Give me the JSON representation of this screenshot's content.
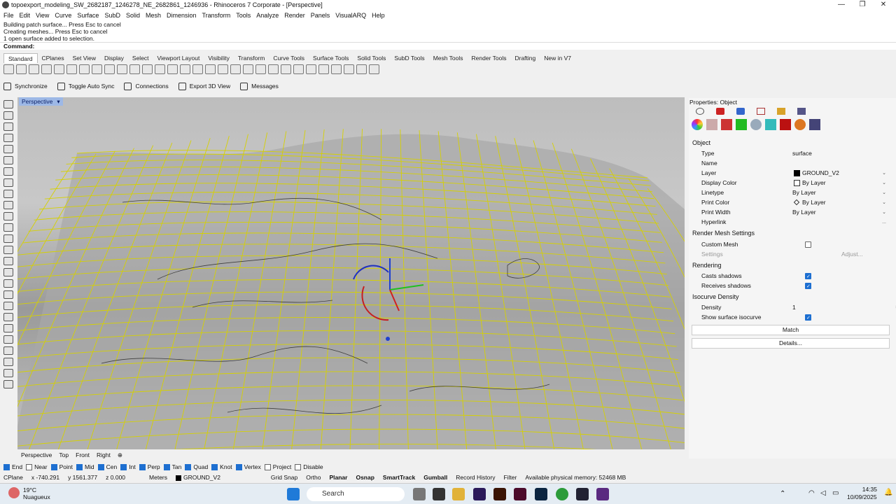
{
  "window": {
    "title": "topoexport_modeling_SW_2682187_1246278_NE_2682861_1246936 - Rhinoceros 7 Corporate - [Perspective]"
  },
  "menu": [
    "File",
    "Edit",
    "View",
    "Curve",
    "Surface",
    "SubD",
    "Solid",
    "Mesh",
    "Dimension",
    "Transform",
    "Tools",
    "Analyze",
    "Render",
    "Panels",
    "VisualARQ",
    "Help"
  ],
  "command_history": [
    "Building patch surface... Press Esc to cancel",
    "Creating meshes... Press Esc to cancel",
    "1 open surface added to selection."
  ],
  "command_prompt": "Command:",
  "toolbar_tabs": [
    "Standard",
    "CPlanes",
    "Set View",
    "Display",
    "Select",
    "Viewport Layout",
    "Visibility",
    "Transform",
    "Curve Tools",
    "Surface Tools",
    "Solid Tools",
    "SubD Tools",
    "Mesh Tools",
    "Render Tools",
    "Drafting",
    "New in V7"
  ],
  "sync_bar": {
    "synchronize": "Synchronize",
    "toggle_auto_sync": "Toggle Auto Sync",
    "connections": "Connections",
    "export_3d_view": "Export 3D View",
    "messages": "Messages"
  },
  "viewport": {
    "label": "Perspective",
    "tabs": [
      "Perspective",
      "Top",
      "Front",
      "Right"
    ],
    "add_tab": "⊕"
  },
  "properties": {
    "header": "Properties: Object",
    "section_object": "Object",
    "rows": [
      {
        "k": "Type",
        "v": "surface"
      },
      {
        "k": "Name",
        "v": ""
      },
      {
        "k": "Layer",
        "v": "GROUND_V2"
      },
      {
        "k": "Display Color",
        "v": "By Layer"
      },
      {
        "k": "Linetype",
        "v": "By Layer"
      },
      {
        "k": "Print Color",
        "v": "By Layer"
      },
      {
        "k": "Print Width",
        "v": "By Layer"
      },
      {
        "k": "Hyperlink",
        "v": ""
      }
    ],
    "section_render_mesh": "Render Mesh Settings",
    "custom_mesh": "Custom Mesh",
    "settings": "Settings",
    "adjust": "Adjust...",
    "section_rendering": "Rendering",
    "casts_shadows": "Casts shadows",
    "receives_shadows": "Receives shadows",
    "section_isocurve": "Isocurve Density",
    "density_label": "Density",
    "density_value": "1",
    "show_isocurve": "Show surface isocurve",
    "match": "Match",
    "details": "Details..."
  },
  "osnaps": [
    {
      "label": "End",
      "on": true
    },
    {
      "label": "Near",
      "on": false
    },
    {
      "label": "Point",
      "on": true
    },
    {
      "label": "Mid",
      "on": true
    },
    {
      "label": "Cen",
      "on": true
    },
    {
      "label": "Int",
      "on": true
    },
    {
      "label": "Perp",
      "on": true
    },
    {
      "label": "Tan",
      "on": true
    },
    {
      "label": "Quad",
      "on": true
    },
    {
      "label": "Knot",
      "on": true
    },
    {
      "label": "Vertex",
      "on": true
    },
    {
      "label": "Project",
      "on": false
    },
    {
      "label": "Disable",
      "on": false
    }
  ],
  "status": {
    "cplane": "CPlane",
    "x": "x -740.291",
    "y": "y 1561.377",
    "z": "z 0.000",
    "units": "Meters",
    "layer": "GROUND_V2",
    "grid_snap": "Grid Snap",
    "ortho": "Ortho",
    "planar": "Planar",
    "osnap": "Osnap",
    "smarttrack": "SmartTrack",
    "gumball": "Gumball",
    "record_history": "Record History",
    "filter": "Filter",
    "memory": "Available physical memory: 52468 MB"
  },
  "taskbar": {
    "temp": "19°C",
    "weather": "Nuagueux",
    "search": "Search",
    "time": "14:35",
    "date": "10/09/2025"
  }
}
